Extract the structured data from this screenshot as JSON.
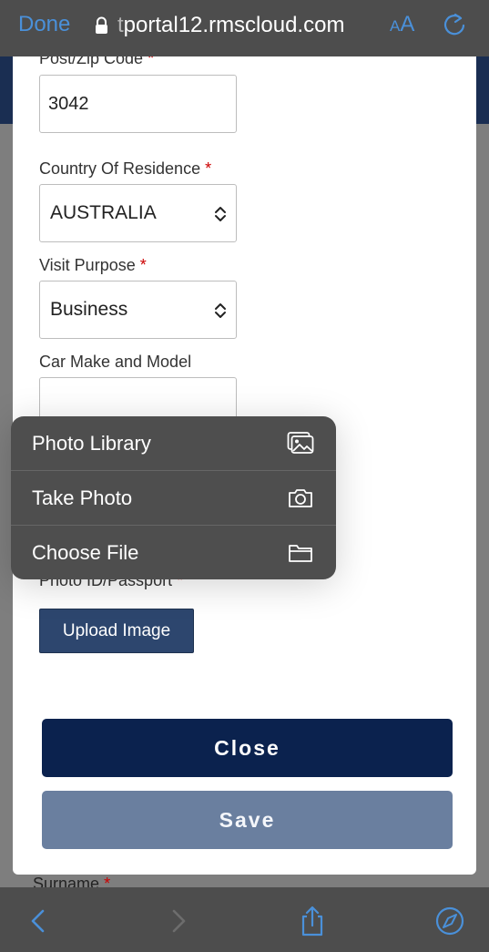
{
  "browser": {
    "done_label": "Done",
    "url_prefix": "t",
    "url_rest": "portal12.rmscloud.com",
    "text_size_label_small": "A",
    "text_size_label_large": "A",
    "accent_color": "#4a90d9"
  },
  "form": {
    "postcode": {
      "label": "Post/Zip Code",
      "required_mark": "*",
      "value": "3042"
    },
    "country": {
      "label": "Country Of Residence",
      "required_mark": "*",
      "value": "AUSTRALIA"
    },
    "visit_purpose": {
      "label": "Visit Purpose",
      "required_mark": "*",
      "value": "Business"
    },
    "car": {
      "label": "Car Make and Model",
      "value": ""
    },
    "photo_id": {
      "label": "Photo ID/Passport",
      "required_mark": "*"
    },
    "upload_label": "Upload Image",
    "close_label": "Close",
    "save_label": "Save"
  },
  "background": {
    "surname_label": "Surname",
    "required_mark": "*"
  },
  "file_menu": {
    "items": [
      {
        "label": "Photo Library",
        "icon": "photo-library-icon"
      },
      {
        "label": "Take Photo",
        "icon": "camera-icon"
      },
      {
        "label": "Choose File",
        "icon": "folder-icon"
      }
    ]
  },
  "toolbar": {
    "icons": [
      "back-arrow-icon",
      "forward-arrow-icon",
      "share-icon",
      "compass-icon"
    ]
  }
}
